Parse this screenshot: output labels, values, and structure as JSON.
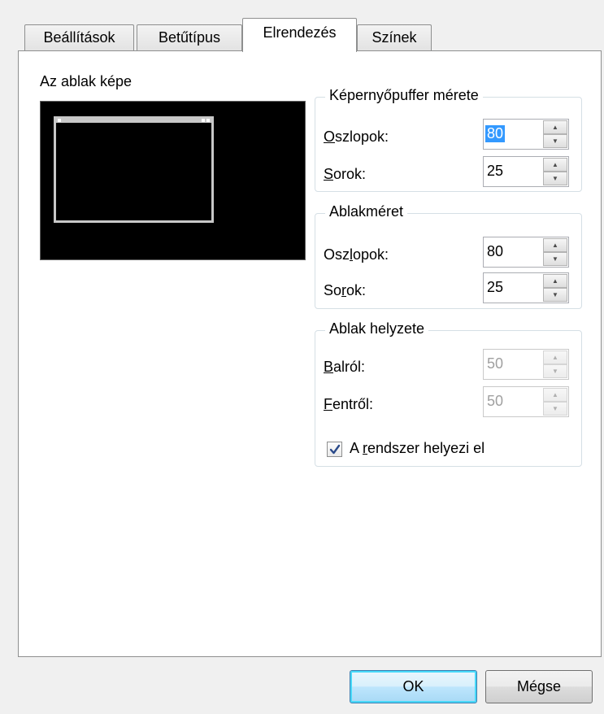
{
  "tabs": [
    {
      "label": "Beállítások",
      "active": false
    },
    {
      "label": "Betűtípus",
      "active": false
    },
    {
      "label": "Elrendezés",
      "active": true
    },
    {
      "label": "Színek",
      "active": false
    }
  ],
  "preview": {
    "label": "Az ablak képe"
  },
  "buffer_group": {
    "title": "Képernyőpuffer mérete",
    "columns_label_mnemonic": "O",
    "columns_label_rest": "szlopok:",
    "columns_value": "80",
    "rows_label_mnemonic": "S",
    "rows_label_rest": "orok:",
    "rows_value": "25"
  },
  "window_size_group": {
    "title": "Ablakméret",
    "columns_label_before": "Osz",
    "columns_label_mnemonic": "l",
    "columns_label_after": "opok:",
    "columns_value": "80",
    "rows_label_before": "So",
    "rows_label_mnemonic": "r",
    "rows_label_after": "ok:",
    "rows_value": "25"
  },
  "position_group": {
    "title": "Ablak helyzete",
    "left_label_mnemonic": "B",
    "left_label_rest": "alról:",
    "left_value": "50",
    "top_label_mnemonic": "F",
    "top_label_rest": "entről:",
    "top_value": "50",
    "auto_label_before": "A ",
    "auto_label_mnemonic": "r",
    "auto_label_after": "endszer helyezi el",
    "auto_checked": true
  },
  "buttons": {
    "ok": "OK",
    "cancel": "Mégse"
  },
  "colors": {
    "selection": "#3399ff",
    "default_button_border": "#3c7fb1",
    "preview_bg": "#000000"
  }
}
